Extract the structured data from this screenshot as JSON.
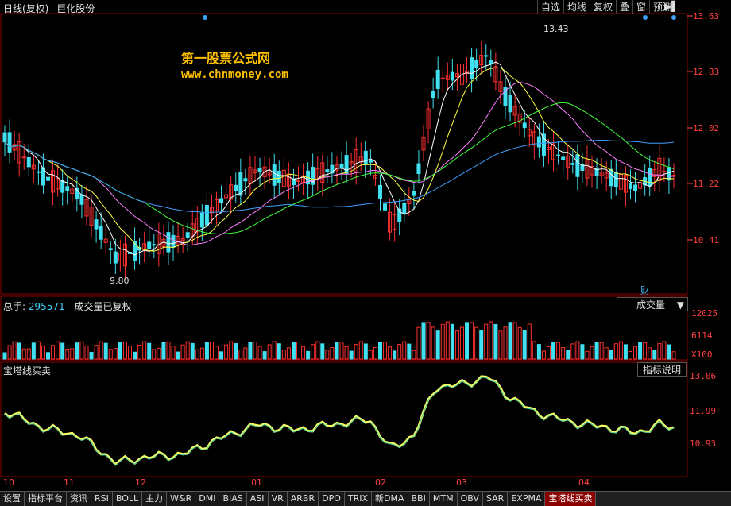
{
  "topbar": {
    "period": "日线(复权)",
    "stock_name": "巨化股份"
  },
  "toolbar": {
    "items": [
      "自选",
      "均线",
      "复权",
      "叠",
      "窗",
      "预测"
    ]
  },
  "watermark": {
    "site_name": "第一股票公式网",
    "site_url": "www.chnmoney.com"
  },
  "price_panel": {
    "axis_ticks": [
      "13.63",
      "12.83",
      "12.02",
      "11.22",
      "10.41"
    ],
    "high_marker": "13.43",
    "low_marker": "9.80",
    "fin_label": "财"
  },
  "volume_panel": {
    "total_label": "总手:",
    "total_value": "295571",
    "title": "成交量已复权",
    "selector": "成交量",
    "axis_ticks": [
      "12025",
      "6114",
      "X100"
    ]
  },
  "tower_panel": {
    "title": "宝塔线买卖",
    "button": "指标说明",
    "axis_ticks": [
      "13.06",
      "11.99",
      "10.93"
    ]
  },
  "x_axis": {
    "labels": [
      "10",
      "11",
      "12",
      "01",
      "02",
      "03",
      "04"
    ]
  },
  "tabs": [
    "设置",
    "指标平台",
    "资讯",
    "RSI",
    "BOLL",
    "主力",
    "W&R",
    "DMI",
    "BIAS",
    "ASI",
    "VR",
    "ARBR",
    "DPO",
    "TRIX",
    "新DMA",
    "BBI",
    "MTM",
    "OBV",
    "SAR",
    "EXPMA",
    "宝塔线买卖"
  ],
  "active_tab": "宝塔线买卖",
  "colors": {
    "up": "#ff3030",
    "down": "#40e0f0",
    "axis": "#ff4040",
    "ma5": "#ffffff",
    "ma10": "#ffff40",
    "ma20": "#ff80ff",
    "ma30": "#40ff40",
    "ma60": "#40a0ff"
  }
}
